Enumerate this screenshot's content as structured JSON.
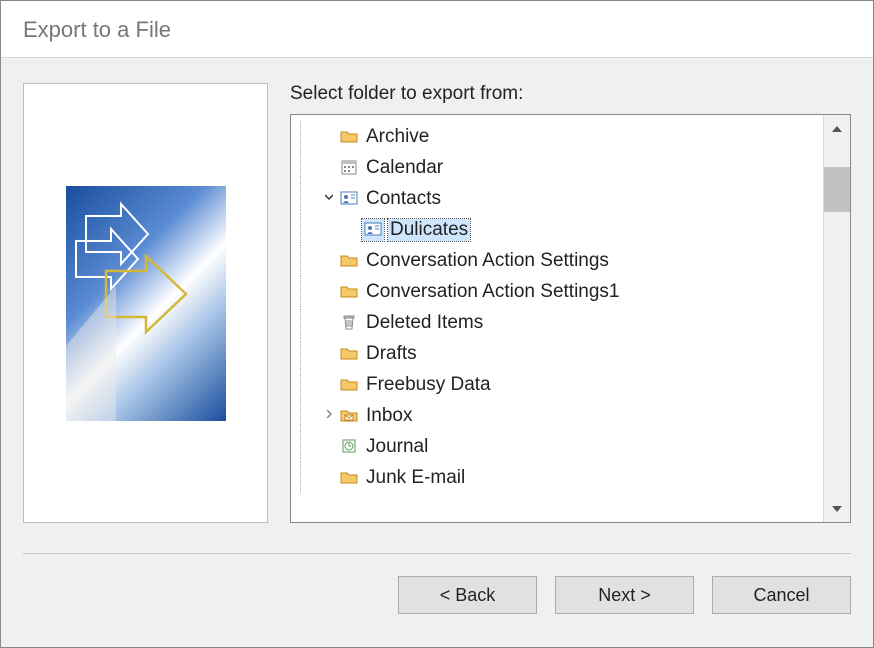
{
  "window": {
    "title": "Export to a File"
  },
  "prompt": "Select folder to export from:",
  "tree": {
    "items": [
      {
        "label": "Archive",
        "icon": "folder",
        "level": 1,
        "expander": ""
      },
      {
        "label": "Calendar",
        "icon": "calendar",
        "level": 1,
        "expander": ""
      },
      {
        "label": "Contacts",
        "icon": "contacts",
        "level": 1,
        "expander": "down"
      },
      {
        "label": "Dulicates",
        "icon": "contacts",
        "level": 2,
        "expander": "",
        "selected": true
      },
      {
        "label": "Conversation Action Settings",
        "icon": "folder",
        "level": 1,
        "expander": ""
      },
      {
        "label": "Conversation Action Settings1",
        "icon": "folder",
        "level": 1,
        "expander": ""
      },
      {
        "label": "Deleted Items",
        "icon": "trash",
        "level": 1,
        "expander": ""
      },
      {
        "label": "Drafts",
        "icon": "folder",
        "level": 1,
        "expander": ""
      },
      {
        "label": "Freebusy Data",
        "icon": "folder",
        "level": 1,
        "expander": ""
      },
      {
        "label": "Inbox",
        "icon": "inbox",
        "level": 1,
        "expander": "right"
      },
      {
        "label": "Journal",
        "icon": "journal",
        "level": 1,
        "expander": ""
      },
      {
        "label": "Junk E-mail",
        "icon": "folder",
        "level": 1,
        "expander": ""
      }
    ]
  },
  "buttons": {
    "back": "< Back",
    "next": "Next >",
    "cancel": "Cancel"
  }
}
